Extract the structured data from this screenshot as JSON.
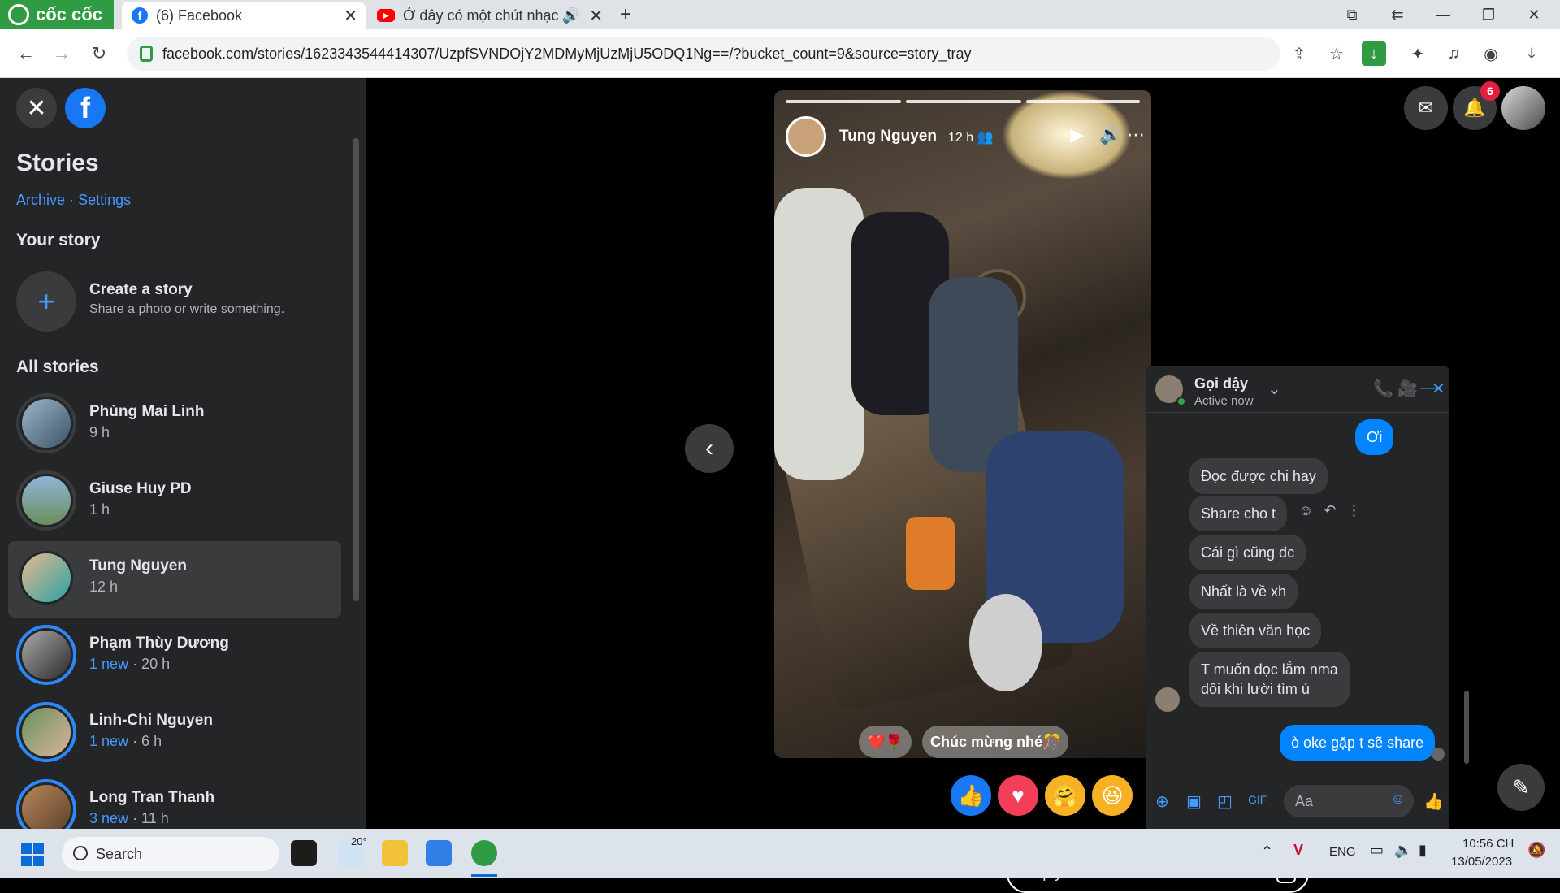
{
  "browser": {
    "brand": "cốc cốc",
    "tabs": [
      {
        "title": "(6) Facebook",
        "active": true
      },
      {
        "title": "Ở đây có một chút nhạc",
        "active": false
      }
    ],
    "url": "facebook.com/stories/1623343544414307/UzpfSVNDOjY2MDMyMjUzMjU5ODQ1Ng==/?bucket_count=9&source=story_tray"
  },
  "sidebar": {
    "title": "Stories",
    "links": {
      "archive": "Archive",
      "separator": "·",
      "settings": "Settings"
    },
    "your_story_heading": "Your story",
    "create": {
      "title": "Create a story",
      "subtitle": "Share a photo or write something."
    },
    "all_stories_heading": "All stories",
    "stories": [
      {
        "name": "Phùng Mai Linh",
        "new_label": "",
        "time": "9 h",
        "selected": false,
        "has_new": false
      },
      {
        "name": "Giuse Huy PD",
        "new_label": "",
        "time": "1 h",
        "selected": false,
        "has_new": false
      },
      {
        "name": "Tung Nguyen",
        "new_label": "",
        "time": "12 h",
        "selected": true,
        "has_new": false
      },
      {
        "name": "Phạm Thùy Dương",
        "new_label": "1 new",
        "time": "· 20 h",
        "selected": false,
        "has_new": true
      },
      {
        "name": "Linh-Chi Nguyen",
        "new_label": "1 new",
        "time": "· 6 h",
        "selected": false,
        "has_new": true
      },
      {
        "name": "Long Tran Thanh",
        "new_label": "3 new",
        "time": "· 11 h",
        "selected": false,
        "has_new": true
      }
    ]
  },
  "story": {
    "author": "Tung Nguyen",
    "time": "12 h",
    "reaction_chip": "❤️🌹",
    "caption_chip": "Chúc mừng nhé🎊",
    "reply_placeholder": "Reply...",
    "progress_segments": 3,
    "progress_active": 3
  },
  "header_right": {
    "notifications_count": "6"
  },
  "chat": {
    "name": "Gọi dậy",
    "status": "Active now",
    "messages": [
      {
        "text": "Ơi",
        "from_me": true
      },
      {
        "text": "Đọc được chi hay",
        "from_me": false
      },
      {
        "text": "Share cho t",
        "from_me": false
      },
      {
        "text": "Cái gì cũng đc",
        "from_me": false
      },
      {
        "text": "Nhất là về xh",
        "from_me": false
      },
      {
        "text": "Về thiên văn học",
        "from_me": false
      },
      {
        "text": "T muốn đọc lắm nma\ndôi khi lười tìm ú",
        "from_me": false
      },
      {
        "text": "ò oke gặp t sẽ share",
        "from_me": true
      }
    ],
    "input_placeholder": "Aa"
  },
  "taskbar": {
    "search_label": "Search",
    "weather": "20°",
    "language": "ENG",
    "time": "10:56 CH",
    "date": "13/05/2023"
  },
  "colors": {
    "facebook_blue": "#1877f2",
    "messenger_blue": "#0084ff",
    "sidebar_bg": "#242526",
    "coccoc_green": "#2f9b43"
  }
}
